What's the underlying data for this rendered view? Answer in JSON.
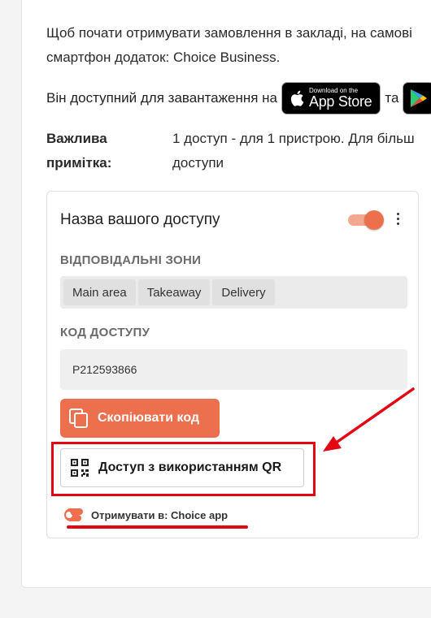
{
  "intro": {
    "line1": "Щоб почати отримувати замовлення в закладі, на самові",
    "line2": "смартфон додаток: Choice Business."
  },
  "availability": {
    "text": "Він доступний для завантаження на",
    "connector": "та",
    "appstore_small": "Download on the",
    "appstore_big": "App Store"
  },
  "note": {
    "label_line1": "Важлива",
    "label_line2": "примітка:",
    "text_line1": "1 доступ - для 1 пристрою. Для більш",
    "text_line2": "доступи"
  },
  "access_card": {
    "title": "Назва вашого доступу",
    "toggle_on": true,
    "zones_label": "ВІДПОВІДАЛЬНІ ЗОНИ",
    "zones": [
      "Main area",
      "Takeaway",
      "Delivery"
    ],
    "code_label": "КОД ДОСТУПУ",
    "code_value": "P212593866",
    "copy_button": "Скопіювати код",
    "qr_button": "Доступ з використанням QR",
    "get_in": "Отримувати в: Choice app"
  },
  "colors": {
    "accent": "#ec6f4e",
    "annotation": "#e30613"
  },
  "icons": [
    "apple-icon",
    "google-play-icon",
    "kebab-menu-icon",
    "copy-icon",
    "qr-code-icon",
    "choice-logo-icon"
  ]
}
